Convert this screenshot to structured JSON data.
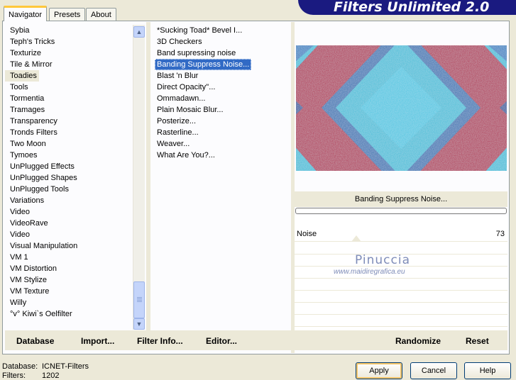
{
  "app": {
    "title": "Filters Unlimited 2.0"
  },
  "tabs": [
    {
      "label": "Navigator",
      "active": true
    },
    {
      "label": "Presets",
      "active": false
    },
    {
      "label": "About",
      "active": false
    }
  ],
  "categories": [
    "Sybia",
    "Teph's Tricks",
    "Texturize",
    "Tile & Mirror",
    "Toadies",
    "Tools",
    "Tormentia",
    "Tramages",
    "Transparency",
    "Tronds Filters",
    "Two Moon",
    "Tymoes",
    "UnPlugged Effects",
    "UnPlugged Shapes",
    "UnPlugged Tools",
    "Variations",
    "Video",
    "VideoRave",
    "Video",
    "Visual Manipulation",
    "VM 1",
    "VM Distortion",
    "VM Stylize",
    "VM Texture",
    "Willy",
    "°v° Kiwi`s Oelfilter"
  ],
  "selected_category": "Toadies",
  "filters": [
    "*Sucking Toad*  Bevel I...",
    "3D Checkers",
    "Band supressing noise",
    "Banding Suppress Noise...",
    "Blast 'n Blur",
    "Direct Opacity''...",
    "Ommadawn...",
    "Plain Mosaic Blur...",
    "Posterize...",
    "Rasterline...",
    "Weaver...",
    "What Are You?..."
  ],
  "selected_filter": "Banding Suppress Noise...",
  "left_buttons": {
    "database": "Database",
    "import": "Import...",
    "filter_info": "Filter Info...",
    "editor": "Editor..."
  },
  "right_buttons": {
    "randomize": "Randomize",
    "reset": "Reset"
  },
  "preview": {
    "filter_name": "Banding Suppress Noise...",
    "colors": {
      "cyan": "#39bdd6",
      "crimson": "#b01a48",
      "navy": "#1f2f80"
    }
  },
  "controls": [
    {
      "label": "Noise",
      "value": "73"
    }
  ],
  "watermark": {
    "line1": "Pinuccia",
    "line2": "www.maidiregrafica.eu"
  },
  "footer": {
    "database_label": "Database:",
    "database_value": "ICNET-Filters",
    "filters_label": "Filters:",
    "filters_value": "1202"
  },
  "dialog_buttons": {
    "apply": "Apply",
    "cancel": "Cancel",
    "help": "Help"
  }
}
